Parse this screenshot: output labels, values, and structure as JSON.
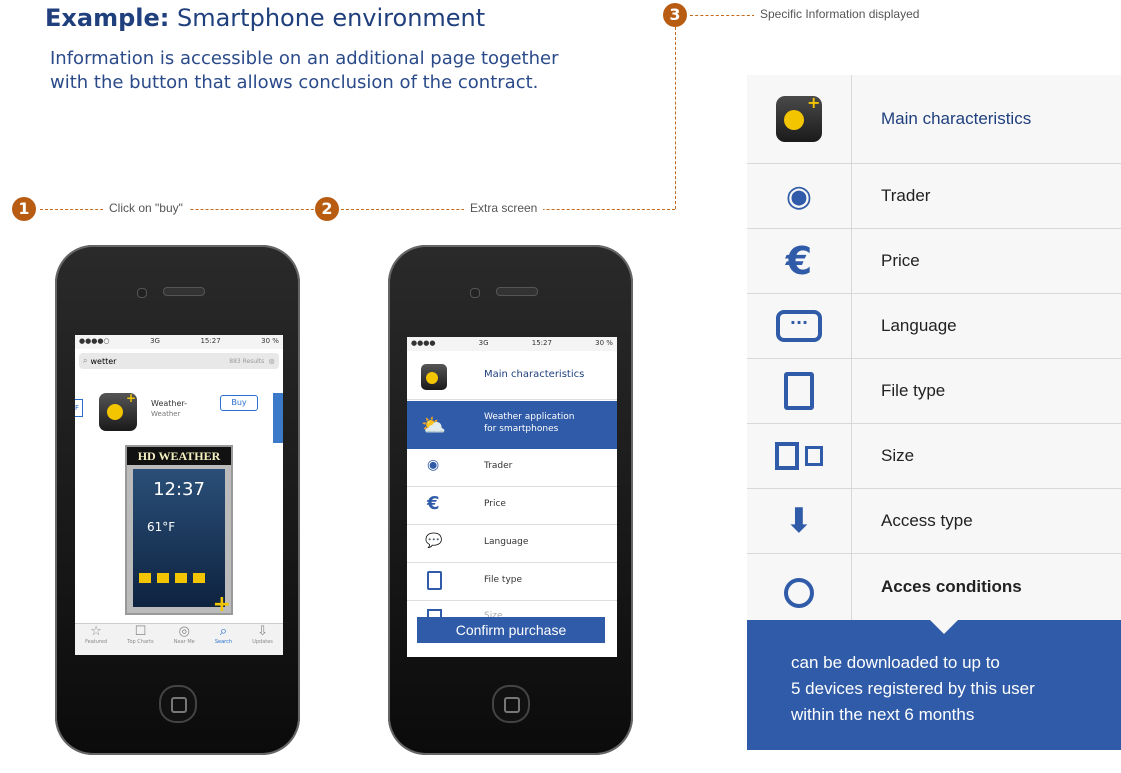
{
  "header": {
    "title_bold": "Example:",
    "title_rest": " Smartphone environment",
    "intro": "Information is accessible on an additional page together with the button that allows conclusion of the contract."
  },
  "steps": [
    {
      "num": "1",
      "label": "Click on \"buy\""
    },
    {
      "num": "2",
      "label": "Extra screen"
    },
    {
      "num": "3",
      "label": "Specific Information displayed"
    }
  ],
  "phone1": {
    "status_left": "●●●●○",
    "status_net": "3G",
    "status_time": "15:27",
    "status_batt": "30 %",
    "search_value": "wetter",
    "results": "883 Results",
    "app_name": "Weather-",
    "app_sub": "Weather",
    "buy_label": "Buy",
    "banner": "HD WEATHER",
    "clock": "12:37",
    "temp": "61°F",
    "tabs": [
      "Featured",
      "Top Charts",
      "Near Me",
      "Search",
      "Updates"
    ]
  },
  "phone2": {
    "status_left": "●●●●",
    "status_net": "3G",
    "status_time": "15:27",
    "status_batt": "30 %",
    "header": "Main characteristics",
    "highlight_line1": "Weather application",
    "highlight_line2": "for smartphones",
    "items": [
      "Trader",
      "Price",
      "Language",
      "File type",
      "Size"
    ],
    "confirm": "Confirm purchase"
  },
  "panel": {
    "rows": [
      {
        "icon": "app-icon",
        "label": "Main characteristics"
      },
      {
        "icon": "trader-pin-icon",
        "label": "Trader"
      },
      {
        "icon": "euro-icon",
        "label": "Price"
      },
      {
        "icon": "speech-bubble-icon",
        "label": "Language"
      },
      {
        "icon": "file-icon",
        "label": "File type"
      },
      {
        "icon": "size-icon",
        "label": "Size"
      },
      {
        "icon": "download-icon",
        "label": "Access type"
      },
      {
        "icon": "lock-icon",
        "label": "Acces conditions"
      }
    ],
    "info_line1": "can be downloaded to up to",
    "info_line2": "5 devices registered by this user",
    "info_line3": "within the next 6 months"
  },
  "colors": {
    "brand": "#1f3f7d",
    "accent": "#2f5ba8",
    "step": "#b85c12"
  }
}
